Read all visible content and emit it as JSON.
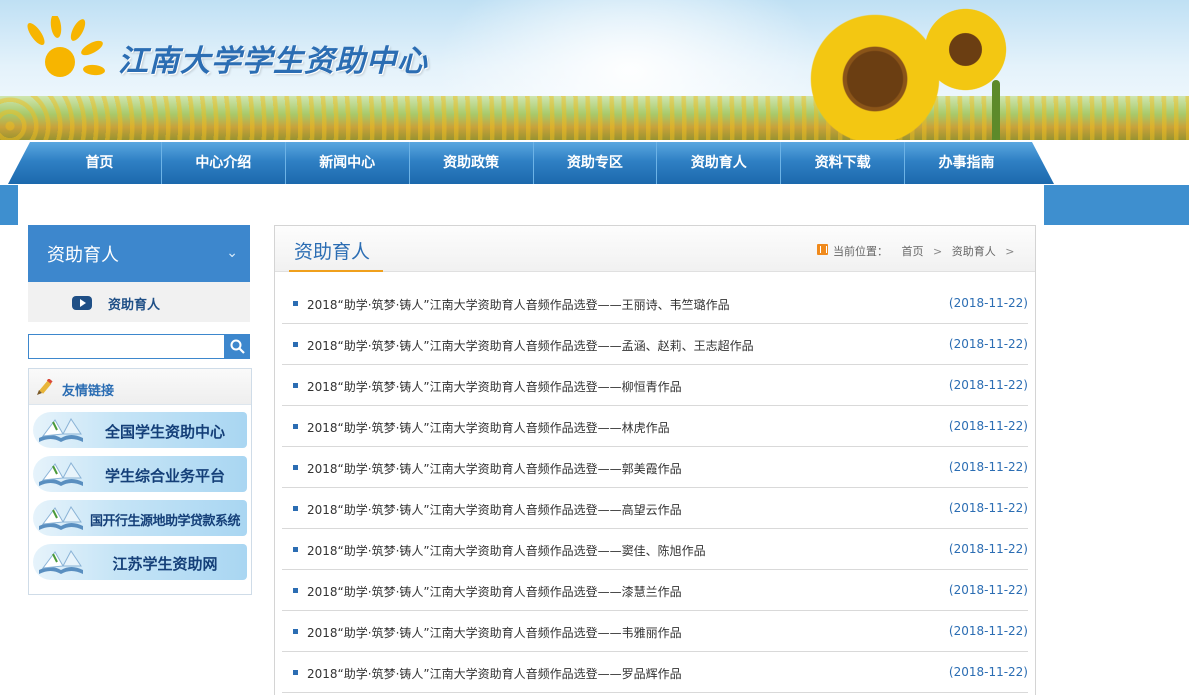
{
  "header": {
    "site_title": "江南大学学生资助中心"
  },
  "nav": {
    "items": [
      "首页",
      "中心介绍",
      "新闻中心",
      "资助政策",
      "资助专区",
      "资助育人",
      "资料下载",
      "办事指南"
    ]
  },
  "sidebar": {
    "section_title": "资助育人",
    "sub_item": "资助育人",
    "search": {
      "value": "",
      "placeholder": ""
    },
    "links_title": "友情链接",
    "links": [
      "全国学生资助中心",
      "学生综合业务平台",
      "国开行生源地助学贷款系统",
      "江苏学生资助网"
    ]
  },
  "main": {
    "title": "资助育人",
    "breadcrumb": {
      "label": "当前位置：",
      "items": [
        "首页",
        "资助育人"
      ],
      "separator": ">"
    },
    "news": [
      {
        "title": "2018“助学·筑梦·铸人”江南大学资助育人音频作品选登——王丽诗、韦竺璐作品",
        "date": "(2018-11-22)"
      },
      {
        "title": "2018“助学·筑梦·铸人”江南大学资助育人音频作品选登——孟涵、赵莉、王志超作品",
        "date": "(2018-11-22)"
      },
      {
        "title": "2018“助学·筑梦·铸人”江南大学资助育人音频作品选登——柳恒青作品",
        "date": "(2018-11-22)"
      },
      {
        "title": "2018“助学·筑梦·铸人”江南大学资助育人音频作品选登——林虎作品",
        "date": "(2018-11-22)"
      },
      {
        "title": "2018“助学·筑梦·铸人”江南大学资助育人音频作品选登——郭美霞作品",
        "date": "(2018-11-22)"
      },
      {
        "title": "2018“助学·筑梦·铸人”江南大学资助育人音频作品选登——高望云作品",
        "date": "(2018-11-22)"
      },
      {
        "title": "2018“助学·筑梦·铸人”江南大学资助育人音频作品选登——窦佳、陈旭作品",
        "date": "(2018-11-22)"
      },
      {
        "title": "2018“助学·筑梦·铸人”江南大学资助育人音频作品选登——漆慧兰作品",
        "date": "(2018-11-22)"
      },
      {
        "title": "2018“助学·筑梦·铸人”江南大学资助育人音频作品选登——韦雅丽作品",
        "date": "(2018-11-22)"
      },
      {
        "title": "2018“助学·筑梦·铸人”江南大学资助育人音频作品选登——罗品辉作品",
        "date": "(2018-11-22)"
      }
    ]
  },
  "colors": {
    "primary": "#3d87cd",
    "nav": "#2f80c4",
    "accent": "#f0a01c",
    "title_blue": "#2b6db3"
  },
  "icons": [
    "sun-logo-icon",
    "play-icon",
    "search-icon",
    "pencil-icon",
    "book-icon",
    "chevron-down-icon",
    "breadcrumb-home-icon"
  ]
}
